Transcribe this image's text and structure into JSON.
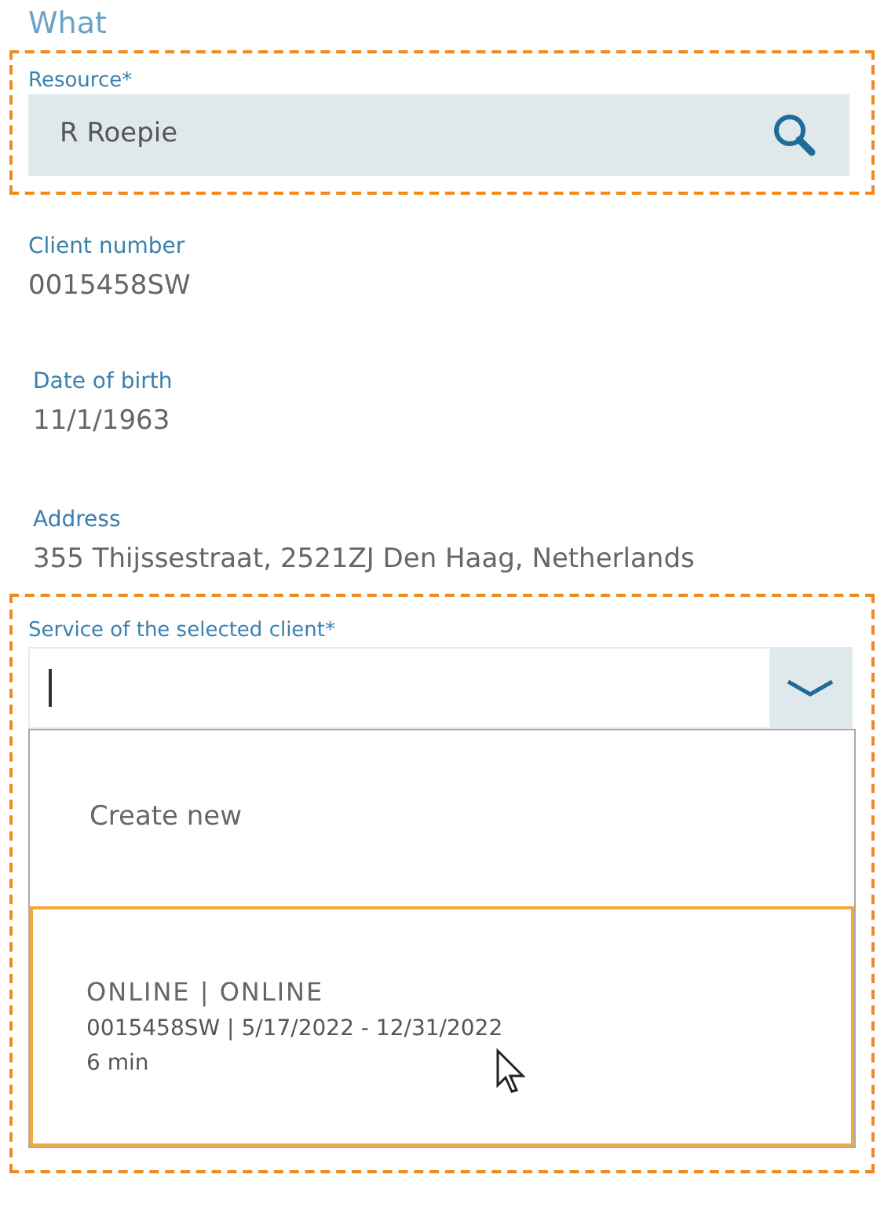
{
  "section_title": "What",
  "resource": {
    "label": "Resource*",
    "value": "R Roepie"
  },
  "details": [
    {
      "label": "Client number",
      "value": "0015458SW"
    },
    {
      "label": "Date of birth",
      "value": "11/1/1963"
    },
    {
      "label": "Address",
      "value": "355 Thijssestraat, 2521ZJ Den Haag, Netherlands"
    }
  ],
  "service": {
    "label": "Service of the selected client*",
    "expanded": true,
    "options": [
      {
        "kind": "action",
        "lines": [
          "Create new"
        ],
        "selected": false
      },
      {
        "kind": "service",
        "lines": [
          "ONLINE | ONLINE",
          "0015458SW | 5/17/2022 - 12/31/2022",
          "6 min"
        ],
        "selected": true
      }
    ]
  }
}
